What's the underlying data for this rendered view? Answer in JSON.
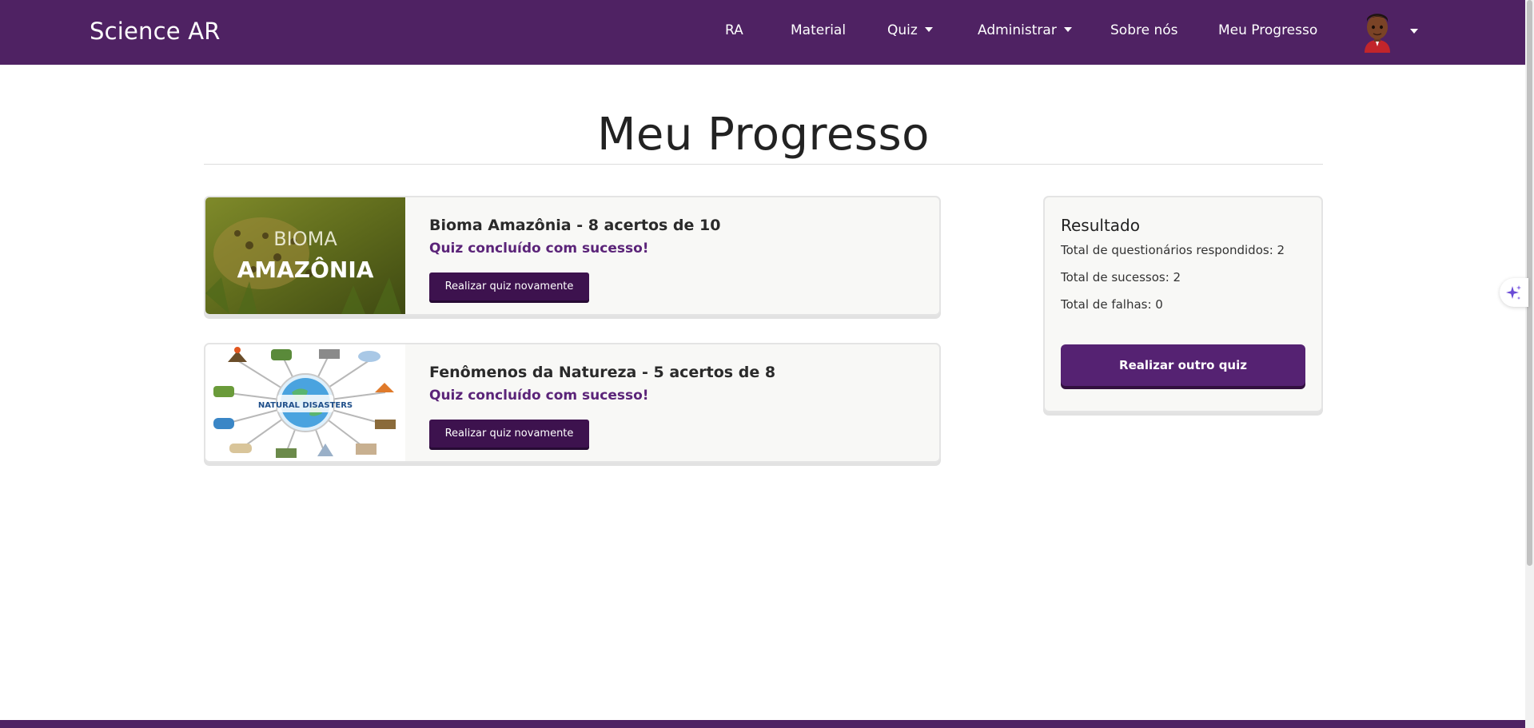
{
  "navbar": {
    "brand": "Science AR",
    "links": [
      {
        "label": "RA"
      },
      {
        "label": "Material"
      },
      {
        "label": "Quiz"
      },
      {
        "label": "Administrar"
      },
      {
        "label": "Sobre nós"
      },
      {
        "label": "Meu Progresso"
      }
    ],
    "avatar_icon": "user-avatar-icon",
    "color": "#4f2263"
  },
  "page": {
    "title": "Meu Progresso"
  },
  "quizzes": [
    {
      "image_text_top": "BIOMA",
      "image_text_bottom": "AMAZÔNIA",
      "title": "Bioma Amazônia - 8 acertos de 10",
      "status": "Quiz concluído com sucesso!",
      "button_label": "Realizar quiz novamente"
    },
    {
      "image_text": "NATURAL DISASTERS",
      "title": "Fenômenos da Natureza - 5 acertos de 8",
      "status": "Quiz concluído com sucesso!",
      "button_label": "Realizar quiz novamente"
    }
  ],
  "result": {
    "title": "Resultado",
    "answered": "Total de questionários respondidos: 2",
    "successes": "Total de sucessos: 2",
    "failures": "Total de falhas: 0",
    "button_label": "Realizar outro quiz"
  },
  "colors": {
    "primary": "#4f2263",
    "button_dark": "#3d124e",
    "status_text": "#5b2479"
  }
}
